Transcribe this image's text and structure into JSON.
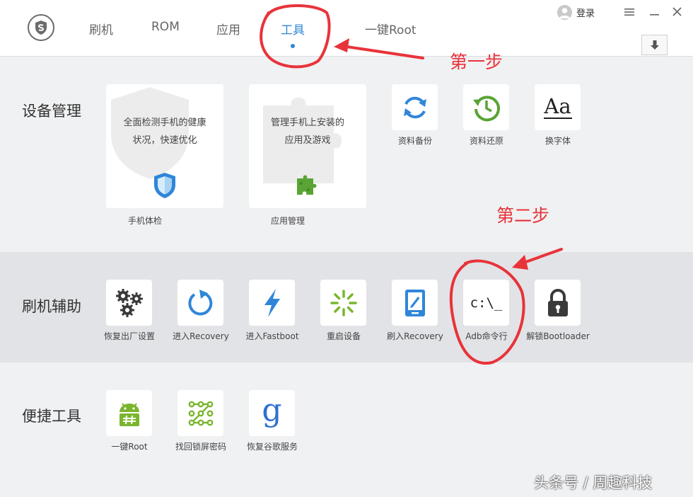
{
  "nav": {
    "tabs": [
      {
        "label": "刷机"
      },
      {
        "label": "ROM"
      },
      {
        "label": "应用"
      },
      {
        "label": "工具"
      },
      {
        "label": "一键Root"
      }
    ],
    "active_tab": "工具",
    "login_label": "登录"
  },
  "sections": {
    "device": {
      "title": "设备管理",
      "cards": [
        {
          "label": "手机体检",
          "desc": [
            "全面检测手机的健康",
            "状况，快速优化"
          ],
          "icon": "shield-icon"
        },
        {
          "label": "应用管理",
          "desc": [
            "管理手机上安装的",
            "应用及游戏"
          ],
          "icon": "puzzle-icon"
        }
      ],
      "tiles": [
        {
          "label": "资料备份",
          "icon": "sync-icon"
        },
        {
          "label": "资料还原",
          "icon": "history-icon"
        },
        {
          "label": "换字体",
          "icon": "font-icon",
          "glyph": "Aa"
        }
      ]
    },
    "flash": {
      "title": "刷机辅助",
      "tiles": [
        {
          "label": "恢复出厂设置",
          "icon": "gears-icon"
        },
        {
          "label": "进入Recovery",
          "icon": "refresh-icon"
        },
        {
          "label": "进入Fastboot",
          "icon": "lightning-icon"
        },
        {
          "label": "重启设备",
          "icon": "spinner-icon"
        },
        {
          "label": "刷入Recovery",
          "icon": "tablet-icon"
        },
        {
          "label": "Adb命令行",
          "icon": "terminal-icon",
          "glyph": "c:\\_"
        },
        {
          "label": "解锁Bootloader",
          "icon": "lock-icon"
        }
      ]
    },
    "quick": {
      "title": "便捷工具",
      "tiles": [
        {
          "label": "一键Root",
          "icon": "android-icon"
        },
        {
          "label": "找回锁屏密码",
          "icon": "pattern-lock-icon"
        },
        {
          "label": "恢复谷歌服务",
          "icon": "google-icon",
          "glyph": "g"
        }
      ]
    }
  },
  "annotations": {
    "step1": "第一步",
    "step2": "第二步",
    "color": "#e8333a"
  },
  "watermark": "头条号 / 周趣科技",
  "colors": {
    "accent": "#2f86d9",
    "green": "#7ab52d",
    "dark_icon": "#3a3a3a"
  }
}
